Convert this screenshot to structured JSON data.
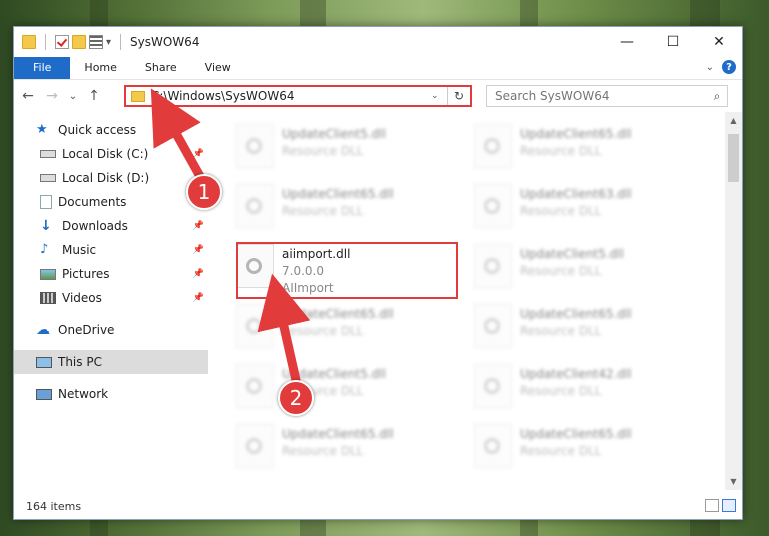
{
  "window": {
    "title": "SysWOW64",
    "minimize_glyph": "—",
    "maximize_glyph": "☐",
    "close_glyph": "✕"
  },
  "ribbon": {
    "tabs": [
      "File",
      "Home",
      "Share",
      "View"
    ],
    "help_glyph": "?",
    "expand_glyph": "⌄"
  },
  "navbar": {
    "back_glyph": "←",
    "forward_glyph": "→",
    "recent_glyph": "⌄",
    "up_glyph": "↑",
    "address": "C:\\Windows\\SysWOW64",
    "dropdown_glyph": "⌄",
    "refresh_glyph": "↻",
    "search_placeholder": "Search SysWOW64",
    "search_glyph": "⌕"
  },
  "sidebar": {
    "items": [
      {
        "label": "Quick access",
        "icon": "star-icon"
      },
      {
        "label": "Local Disk (C:)",
        "icon": "drive-icon"
      },
      {
        "label": "Local Disk (D:)",
        "icon": "drive-icon"
      },
      {
        "label": "Documents",
        "icon": "documents-icon"
      },
      {
        "label": "Downloads",
        "icon": "download-icon"
      },
      {
        "label": "Music",
        "icon": "music-icon"
      },
      {
        "label": "Pictures",
        "icon": "pictures-icon"
      },
      {
        "label": "Videos",
        "icon": "videos-icon"
      },
      {
        "label": "OneDrive",
        "icon": "cloud-icon"
      },
      {
        "label": "This PC",
        "icon": "computer-icon"
      },
      {
        "label": "Network",
        "icon": "network-icon"
      }
    ],
    "pin_glyph": "📌"
  },
  "files": [
    {
      "name": "UpdateClient5.dll",
      "sub": "Resource DLL"
    },
    {
      "name": "UpdateClient65.dll",
      "sub": "Resource DLL"
    },
    {
      "name": "UpdateClient65.dll",
      "sub": "Resource DLL"
    },
    {
      "name": "UpdateClient63.dll",
      "sub": "Resource DLL"
    },
    {
      "name": "aiimport.dll",
      "sub": "7.0.0.0",
      "sub2": "AIImport"
    },
    {
      "name": "UpdateClient5.dll",
      "sub": "Resource DLL"
    },
    {
      "name": "UpdateClient65.dll",
      "sub": "Resource DLL"
    },
    {
      "name": "UpdateClient65.dll",
      "sub": "Resource DLL"
    },
    {
      "name": "UpdateClient5.dll",
      "sub": "Resource DLL"
    },
    {
      "name": "UpdateClient42.dll",
      "sub": "Resource DLL"
    },
    {
      "name": "UpdateClient65.dll",
      "sub": "Resource DLL"
    },
    {
      "name": "UpdateClient65.dll",
      "sub": "Resource DLL"
    }
  ],
  "status": {
    "count": "164 items"
  },
  "callouts": {
    "one": "1",
    "two": "2"
  },
  "colors": {
    "accent": "#1e6cc8",
    "highlight": "#e23b3b"
  }
}
